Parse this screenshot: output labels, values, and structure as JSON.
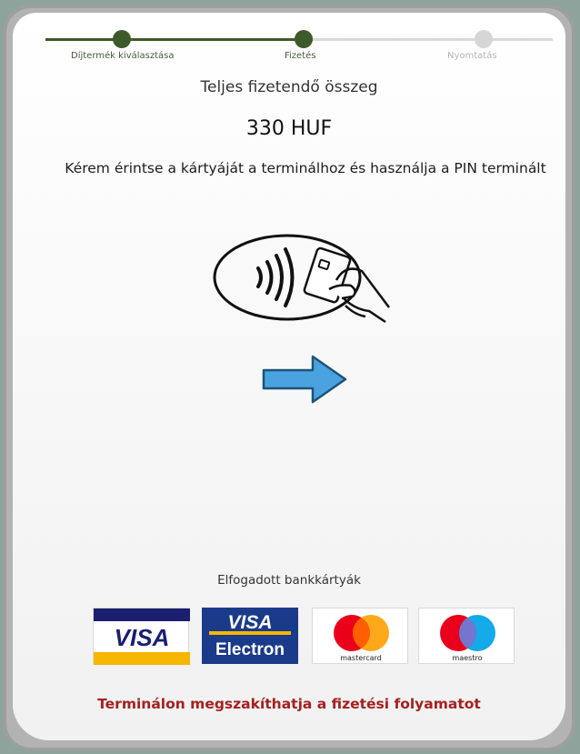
{
  "steps": [
    {
      "label": "Díjtermék kiválasztása",
      "state": "done"
    },
    {
      "label": "Fizetés",
      "state": "current"
    },
    {
      "label": "Nyomtatás",
      "state": "todo"
    }
  ],
  "payment": {
    "total_label": "Teljes fizetendő összeg",
    "amount": "330 HUF",
    "instruction": "Kérem érintse a kártyáját a terminálhoz és használja a PIN terminált"
  },
  "icons": {
    "contactless": "contactless-card-tap-icon",
    "arrow": "right-arrow-icon"
  },
  "cards": {
    "heading": "Elfogadott bankkártyák",
    "visa": "VISA",
    "visa_electron_top": "VISA",
    "visa_electron_bottom": "Electron",
    "mastercard": "mastercard",
    "maestro": "maestro"
  },
  "footer": {
    "cancel_text": "Terminálon megszakíthatja a fizetési folyamatot"
  },
  "colors": {
    "step_active": "#3d5a2a",
    "arrow_fill": "#4aa3df",
    "cancel_text": "#a5201f",
    "visa_blue": "#1a1f71",
    "visa_gold": "#f7b600",
    "mc_red": "#eb001b",
    "mc_orange": "#ff9f00",
    "maestro_blue": "#00a2e5"
  }
}
